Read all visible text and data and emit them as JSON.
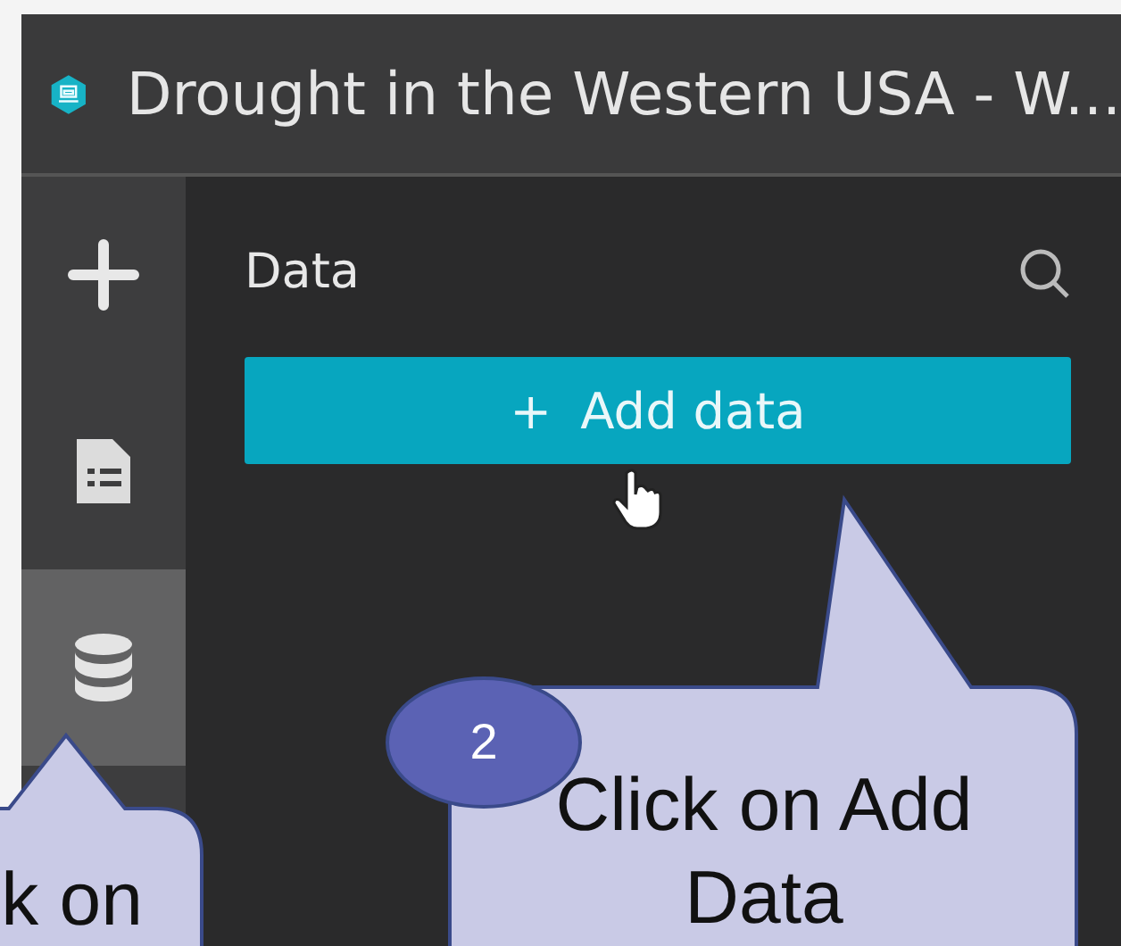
{
  "window": {
    "title": "Drought in the Western USA  - W..."
  },
  "rail": {
    "items": [
      {
        "kind": "plus",
        "selected": false
      },
      {
        "kind": "document",
        "selected": false
      },
      {
        "kind": "database",
        "selected": true
      }
    ]
  },
  "panel": {
    "title": "Data",
    "add_button": {
      "icon": "+",
      "label": "Add data"
    }
  },
  "callouts": [
    {
      "kind": "left",
      "text": "k on"
    },
    {
      "kind": "right",
      "number": "2",
      "text": "Click on Add Data"
    }
  ]
}
